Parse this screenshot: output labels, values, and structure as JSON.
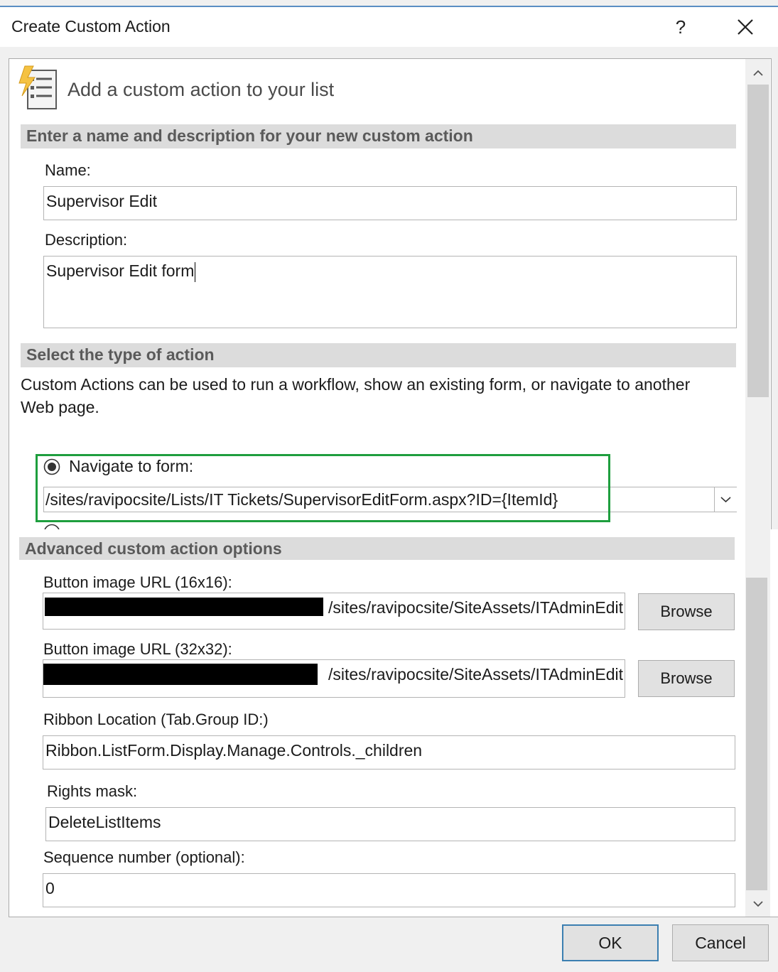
{
  "window": {
    "title": "Create Custom Action",
    "help_label": "?",
    "close_icon": "close-icon"
  },
  "header": {
    "icon": "custom-action-icon",
    "title": "Add a custom action to your list"
  },
  "name_section": {
    "heading": "Enter a name and description for your new custom action",
    "name_label": "Name:",
    "name_value": "Supervisor Edit",
    "description_label": "Description:",
    "description_value": "Supervisor Edit form"
  },
  "action_section": {
    "heading": "Select the type of action",
    "description_line1": "Custom Actions can be used to run a workflow, show an existing form, or navigate to another",
    "description_line2": "Web page.",
    "navigate_label": "Navigate to form:",
    "navigate_url": "/sites/ravipocsite/Lists/IT Tickets/SupervisorEditForm.aspx?ID={ItemId}",
    "highlight_color": "#1e9e3e"
  },
  "advanced_section": {
    "heading": "Advanced custom action options",
    "image16_label": "Button image URL (16x16):",
    "image16_value": "/sites/ravipocsite/SiteAssets/ITAdminEdit",
    "image32_label": "Button image URL (32x32):",
    "image32_value": "/sites/ravipocsite/SiteAssets/ITAdminEdit",
    "browse_label": "Browse",
    "ribbon_label": "Ribbon Location (Tab.Group ID:)",
    "ribbon_value": "Ribbon.ListForm.Display.Manage.Controls._children",
    "rights_label": "Rights mask:",
    "rights_value": "DeleteListItems",
    "sequence_label": "Sequence number (optional):",
    "sequence_value": "0"
  },
  "footer": {
    "ok_label": "OK",
    "cancel_label": "Cancel"
  }
}
